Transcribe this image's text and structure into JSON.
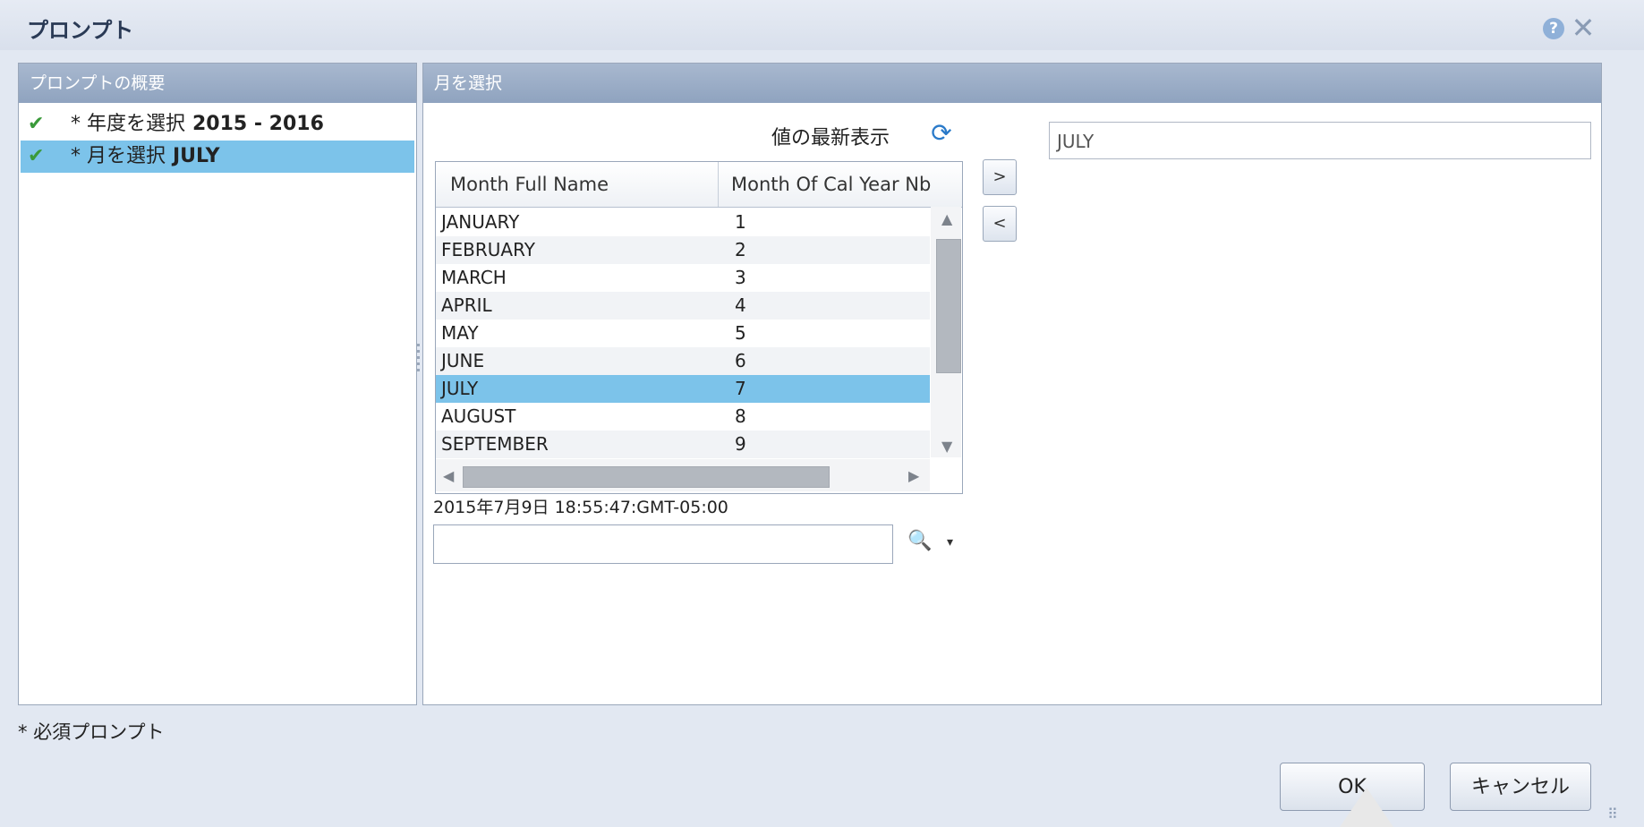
{
  "dialog": {
    "title": "プロンプト",
    "help_symbol": "?",
    "close_symbol": "✕"
  },
  "summary_panel": {
    "header": "プロンプトの概要",
    "items": [
      {
        "label": "* 年度を選択",
        "value": "2015 - 2016",
        "checked": true,
        "selected": false
      },
      {
        "label": "* 月を選択",
        "value": "JULY",
        "checked": true,
        "selected": true
      }
    ],
    "check_symbol": "✔"
  },
  "month_panel": {
    "header": "月を選択",
    "refresh_label": "値の最新表示",
    "refresh_symbol": "⟳",
    "columns": [
      "Month Full Name",
      "Month Of Cal Year Nb"
    ],
    "rows": [
      {
        "name": "JANUARY",
        "num": "1"
      },
      {
        "name": "FEBRUARY",
        "num": "2"
      },
      {
        "name": "MARCH",
        "num": "3"
      },
      {
        "name": "APRIL",
        "num": "4"
      },
      {
        "name": "MAY",
        "num": "5"
      },
      {
        "name": "JUNE",
        "num": "6"
      },
      {
        "name": "JULY",
        "num": "7"
      },
      {
        "name": "AUGUST",
        "num": "8"
      },
      {
        "name": "SEPTEMBER",
        "num": "9"
      }
    ],
    "selected_row": "JULY",
    "move_right_label": ">",
    "move_left_label": "<",
    "selected_value": "JULY",
    "timestamp": "2015年7月9日 18:55:47:GMT-05:00",
    "search_value": "",
    "search_icon_symbol": "🔍",
    "dropdown_symbol": "▾"
  },
  "footer": {
    "required_note": "* 必須プロンプト",
    "ok_label": "OK",
    "cancel_label": "キャンセル"
  },
  "colors": {
    "header_blue": "#8fa3bf",
    "selection_blue": "#7cc3ea",
    "check_green": "#3a9a3a"
  }
}
